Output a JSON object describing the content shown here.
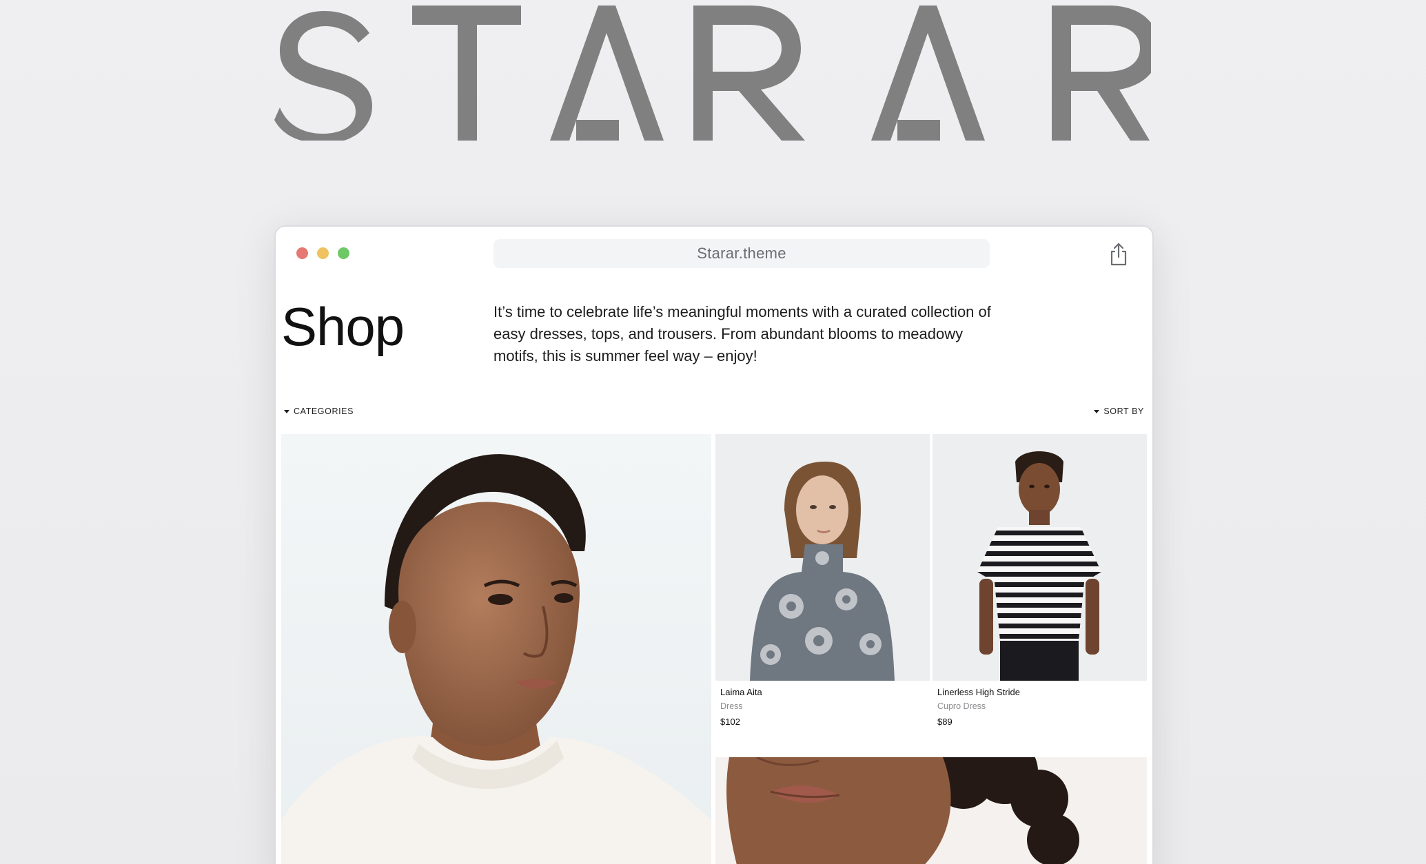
{
  "brand": {
    "logo_text": "STARAR"
  },
  "browser": {
    "url": "Starar.theme",
    "share_icon": "share-icon",
    "traffic_lights": [
      "close",
      "minimize",
      "zoom"
    ]
  },
  "page": {
    "title": "Shop",
    "intro": "It’s time to celebrate life’s meaningful moments with a curated collection of easy dresses, tops, and trousers. From abundant blooms to meadowy motifs, this is summer feel way – enjoy!"
  },
  "filters": {
    "categories_label": "CATEGORIES",
    "sort_label": "SORT BY"
  },
  "products": [
    {
      "name": "Laima Aita",
      "category": "Dress",
      "price": "$102"
    },
    {
      "name": "Linerless High Stride",
      "category": "Cupro Dress",
      "price": "$89"
    }
  ],
  "colors": {
    "background": "#ececee",
    "logo": "#808080",
    "traffic_red": "#e57872",
    "traffic_yellow": "#efc360",
    "traffic_green": "#6fc866"
  }
}
